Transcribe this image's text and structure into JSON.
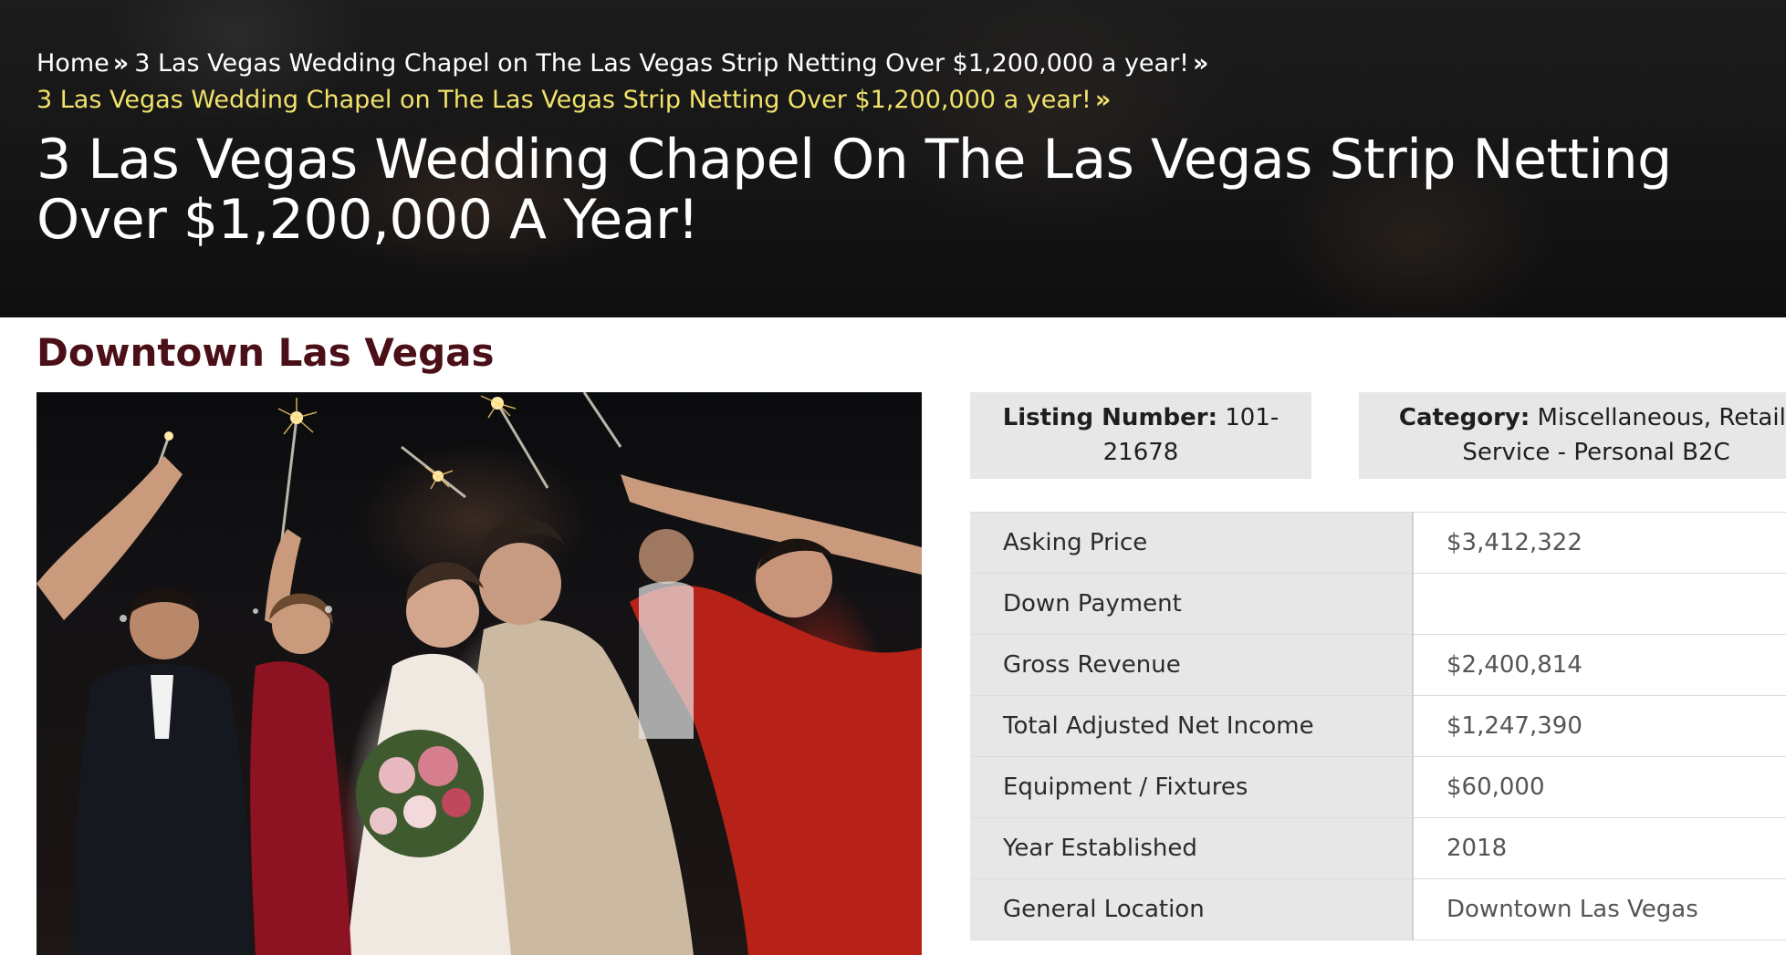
{
  "breadcrumb": {
    "home": "Home",
    "parent": "3 Las Vegas Wedding Chapel on The Las Vegas Strip Netting Over $1,200,000 a year!",
    "current": "3 Las Vegas Wedding Chapel on The Las Vegas Strip Netting Over $1,200,000 a year!",
    "separator": "»"
  },
  "page_title": "3 Las Vegas Wedding Chapel On The Las Vegas Strip Netting Over $1,200,000 A Year!",
  "location_heading": "Downtown Las Vegas",
  "listing": {
    "number_label": "Listing Number:",
    "number_value": "101-21678",
    "category_label": "Category:",
    "category_value": "Miscellaneous, Retail, Service - Personal B2C"
  },
  "details": [
    {
      "label": "Asking Price",
      "value": "$3,412,322"
    },
    {
      "label": "Down Payment",
      "value": ""
    },
    {
      "label": "Gross Revenue",
      "value": "$2,400,814"
    },
    {
      "label": "Total Adjusted Net Income",
      "value": "$1,247,390"
    },
    {
      "label": "Equipment / Fixtures",
      "value": "$60,000"
    },
    {
      "label": "Year Established",
      "value": "2018"
    },
    {
      "label": "General Location",
      "value": "Downtown Las Vegas"
    }
  ],
  "colors": {
    "heading": "#4a0f17",
    "breadcrumb_current": "#f1e26a",
    "badge_bg": "#e7e7e7"
  }
}
